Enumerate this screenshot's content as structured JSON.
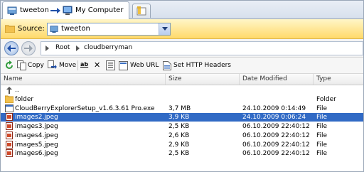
{
  "tab": {
    "title_left": "tweeton",
    "title_right": "My Computer"
  },
  "source": {
    "label": "Source:",
    "value": "tweeton"
  },
  "path": {
    "root": "Root",
    "folder": "cloudberryman"
  },
  "toolbar": {
    "copy": "Copy",
    "move": "Move",
    "rename_glyph": "ab",
    "delete_glyph": "✕",
    "web_url": "Web URL",
    "set_http_headers": "Set HTTP Headers"
  },
  "columns": {
    "name": "Name",
    "size": "Size",
    "date": "Date Modified",
    "type": "Type"
  },
  "up_label": "..",
  "rows": [
    {
      "name": "folder",
      "size": "",
      "date": "",
      "type": "Folder",
      "icon": "folder-icon",
      "selected": false
    },
    {
      "name": "CloudBerryExplorerSetup_v1.6.3.61 Pro.exe",
      "size": "3,7 MB",
      "date": "24.10.2009 0:14:49",
      "type": "File",
      "icon": "exe-file-icon",
      "selected": false
    },
    {
      "name": "images2.jpeg",
      "size": "3,9 KB",
      "date": "24.10.2009 0:06:24",
      "type": "File",
      "icon": "image-file-icon",
      "selected": true
    },
    {
      "name": "images3.jpeg",
      "size": "2,5 KB",
      "date": "06.10.2009 22:40:12",
      "type": "File",
      "icon": "image-file-icon",
      "selected": false
    },
    {
      "name": "images4.jpeg",
      "size": "2,6 KB",
      "date": "06.10.2009 22:40:12",
      "type": "File",
      "icon": "image-file-icon",
      "selected": false
    },
    {
      "name": "images5.jpeg",
      "size": "2,9 KB",
      "date": "06.10.2009 22:40:12",
      "type": "File",
      "icon": "image-file-icon",
      "selected": false
    },
    {
      "name": "images6.jpeg",
      "size": "2,5 KB",
      "date": "06.10.2009 22:40:12",
      "type": "File",
      "icon": "image-file-icon",
      "selected": false
    }
  ],
  "colors": {
    "selection": "#316ac5",
    "source_bar": "#ffd96a",
    "link_blue": "#1f4fa8"
  }
}
